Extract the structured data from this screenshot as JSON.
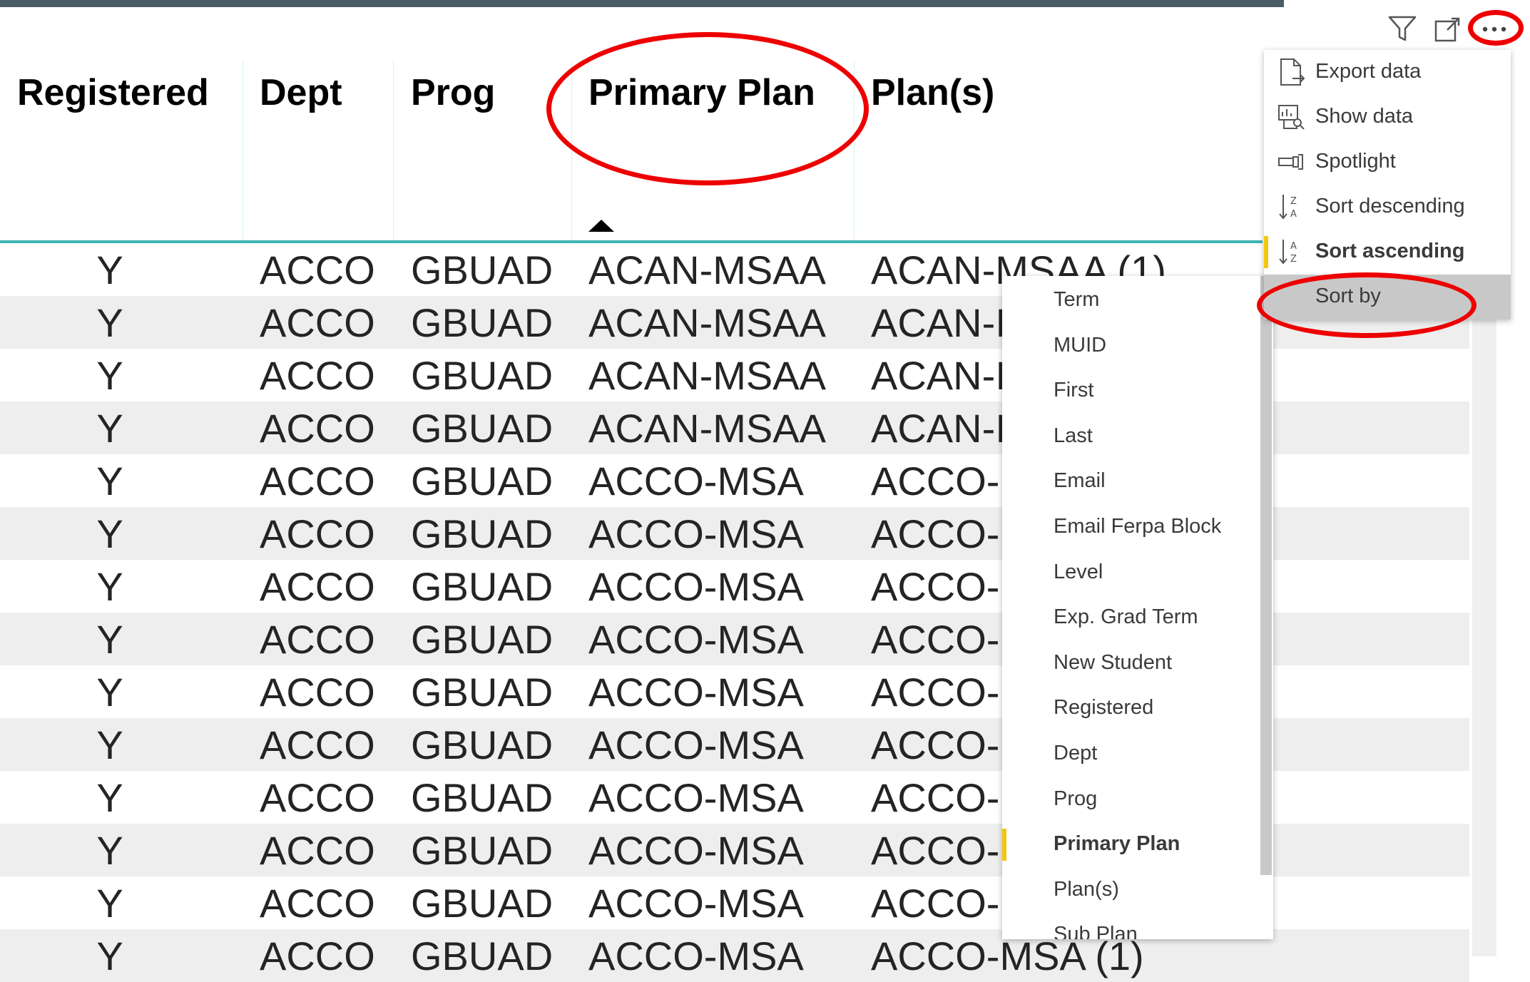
{
  "table": {
    "headers": [
      "Registered",
      "Dept",
      "Prog",
      "Primary Plan",
      "Plan(s)"
    ],
    "sorted_column": "Primary Plan",
    "rows": [
      [
        "Y",
        "ACCO",
        "GBUAD",
        "ACAN-MSAA",
        "ACAN-MSAA (1)"
      ],
      [
        "Y",
        "ACCO",
        "GBUAD",
        "ACAN-MSAA",
        "ACAN-I"
      ],
      [
        "Y",
        "ACCO",
        "GBUAD",
        "ACAN-MSAA",
        "ACAN-I"
      ],
      [
        "Y",
        "ACCO",
        "GBUAD",
        "ACAN-MSAA",
        "ACAN-I"
      ],
      [
        "Y",
        "ACCO",
        "GBUAD",
        "ACCO-MSA",
        "ACCO-"
      ],
      [
        "Y",
        "ACCO",
        "GBUAD",
        "ACCO-MSA",
        "ACCO-"
      ],
      [
        "Y",
        "ACCO",
        "GBUAD",
        "ACCO-MSA",
        "ACCO-"
      ],
      [
        "Y",
        "ACCO",
        "GBUAD",
        "ACCO-MSA",
        "ACCO-"
      ],
      [
        "Y",
        "ACCO",
        "GBUAD",
        "ACCO-MSA",
        "ACCO-"
      ],
      [
        "Y",
        "ACCO",
        "GBUAD",
        "ACCO-MSA",
        "ACCO-"
      ],
      [
        "Y",
        "ACCO",
        "GBUAD",
        "ACCO-MSA",
        "ACCO-"
      ],
      [
        "Y",
        "ACCO",
        "GBUAD",
        "ACCO-MSA",
        "ACCO-"
      ],
      [
        "Y",
        "ACCO",
        "GBUAD",
        "ACCO-MSA",
        "ACCO-"
      ],
      [
        "Y",
        "ACCO",
        "GBUAD",
        "ACCO-MSA",
        "ACCO-MSA (1)"
      ]
    ]
  },
  "toolbar": {
    "icons": [
      "filter-icon",
      "focus-mode-icon",
      "more-options-icon"
    ]
  },
  "context_menu": {
    "items": [
      {
        "label": "Export data",
        "icon": "export-icon"
      },
      {
        "label": "Show data",
        "icon": "show-data-icon"
      },
      {
        "label": "Spotlight",
        "icon": "spotlight-icon"
      },
      {
        "label": "Sort descending",
        "icon": "sort-descending-icon"
      },
      {
        "label": "Sort ascending",
        "icon": "sort-ascending-icon",
        "selected": true
      },
      {
        "label": "Sort by",
        "highlighted": true
      }
    ]
  },
  "sort_by_menu": {
    "items": [
      "Term",
      "MUID",
      "First",
      "Last",
      "Email",
      "Email Ferpa Block",
      "Level",
      "Exp. Grad Term",
      "New Student",
      "Registered",
      "Dept",
      "Prog",
      "Primary Plan",
      "Plan(s)",
      "Sub Plan"
    ],
    "selected": "Primary Plan"
  },
  "colors": {
    "accent_teal": "#3fb4b4",
    "selection_yellow": "#f2c811",
    "annotation_red": "#ee0000",
    "header_bar": "#4a5d66"
  }
}
